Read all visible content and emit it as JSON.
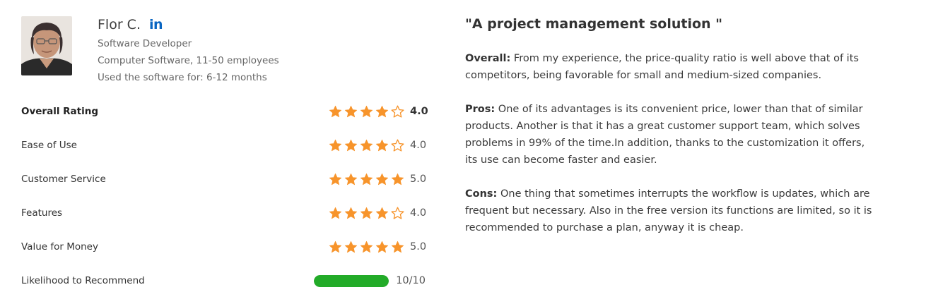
{
  "reviewer": {
    "name": "Flor C.",
    "linkedin_label": "in",
    "title": "Software Developer",
    "company": "Computer Software, 11-50 employees",
    "usage": "Used the software for: 6-12 months"
  },
  "ratings": [
    {
      "label": "Overall Rating",
      "stars": 4,
      "value": "4.0"
    },
    {
      "label": "Ease of Use",
      "stars": 4,
      "value": "4.0"
    },
    {
      "label": "Customer Service",
      "stars": 5,
      "value": "5.0"
    },
    {
      "label": "Features",
      "stars": 4,
      "value": "4.0"
    },
    {
      "label": "Value for Money",
      "stars": 5,
      "value": "5.0"
    }
  ],
  "recommend": {
    "label": "Likelihood to Recommend",
    "score": 10,
    "max": 10,
    "value": "10/10"
  },
  "review": {
    "title": "\"A project management solution \"",
    "overall_label": "Overall:",
    "overall_text": " From my experience, the price-quality ratio is well above that of its competitors, being favorable for small and medium-sized companies.",
    "pros_label": "Pros:",
    "pros_text": " One of its advantages is its convenient price, lower than that of similar products. Another is that it has a great customer support team, which solves problems in 99% of the time.In addition, thanks to the customization it offers, its use can become faster and easier.",
    "cons_label": "Cons:",
    "cons_text": " One thing that sometimes interrupts the workflow is updates, which are frequent but necessary. Also in the free version its functions are limited, so it is recommended to purchase a plan, anyway it is cheap."
  },
  "colors": {
    "star_fill": "#f7942b",
    "star_empty_stroke": "#f7942b",
    "progress_fill": "#22ab28",
    "linkedin": "#0a66c2"
  },
  "icons": {
    "star": "star-icon",
    "star_empty": "star-outline-icon",
    "linkedin": "linkedin-icon"
  }
}
